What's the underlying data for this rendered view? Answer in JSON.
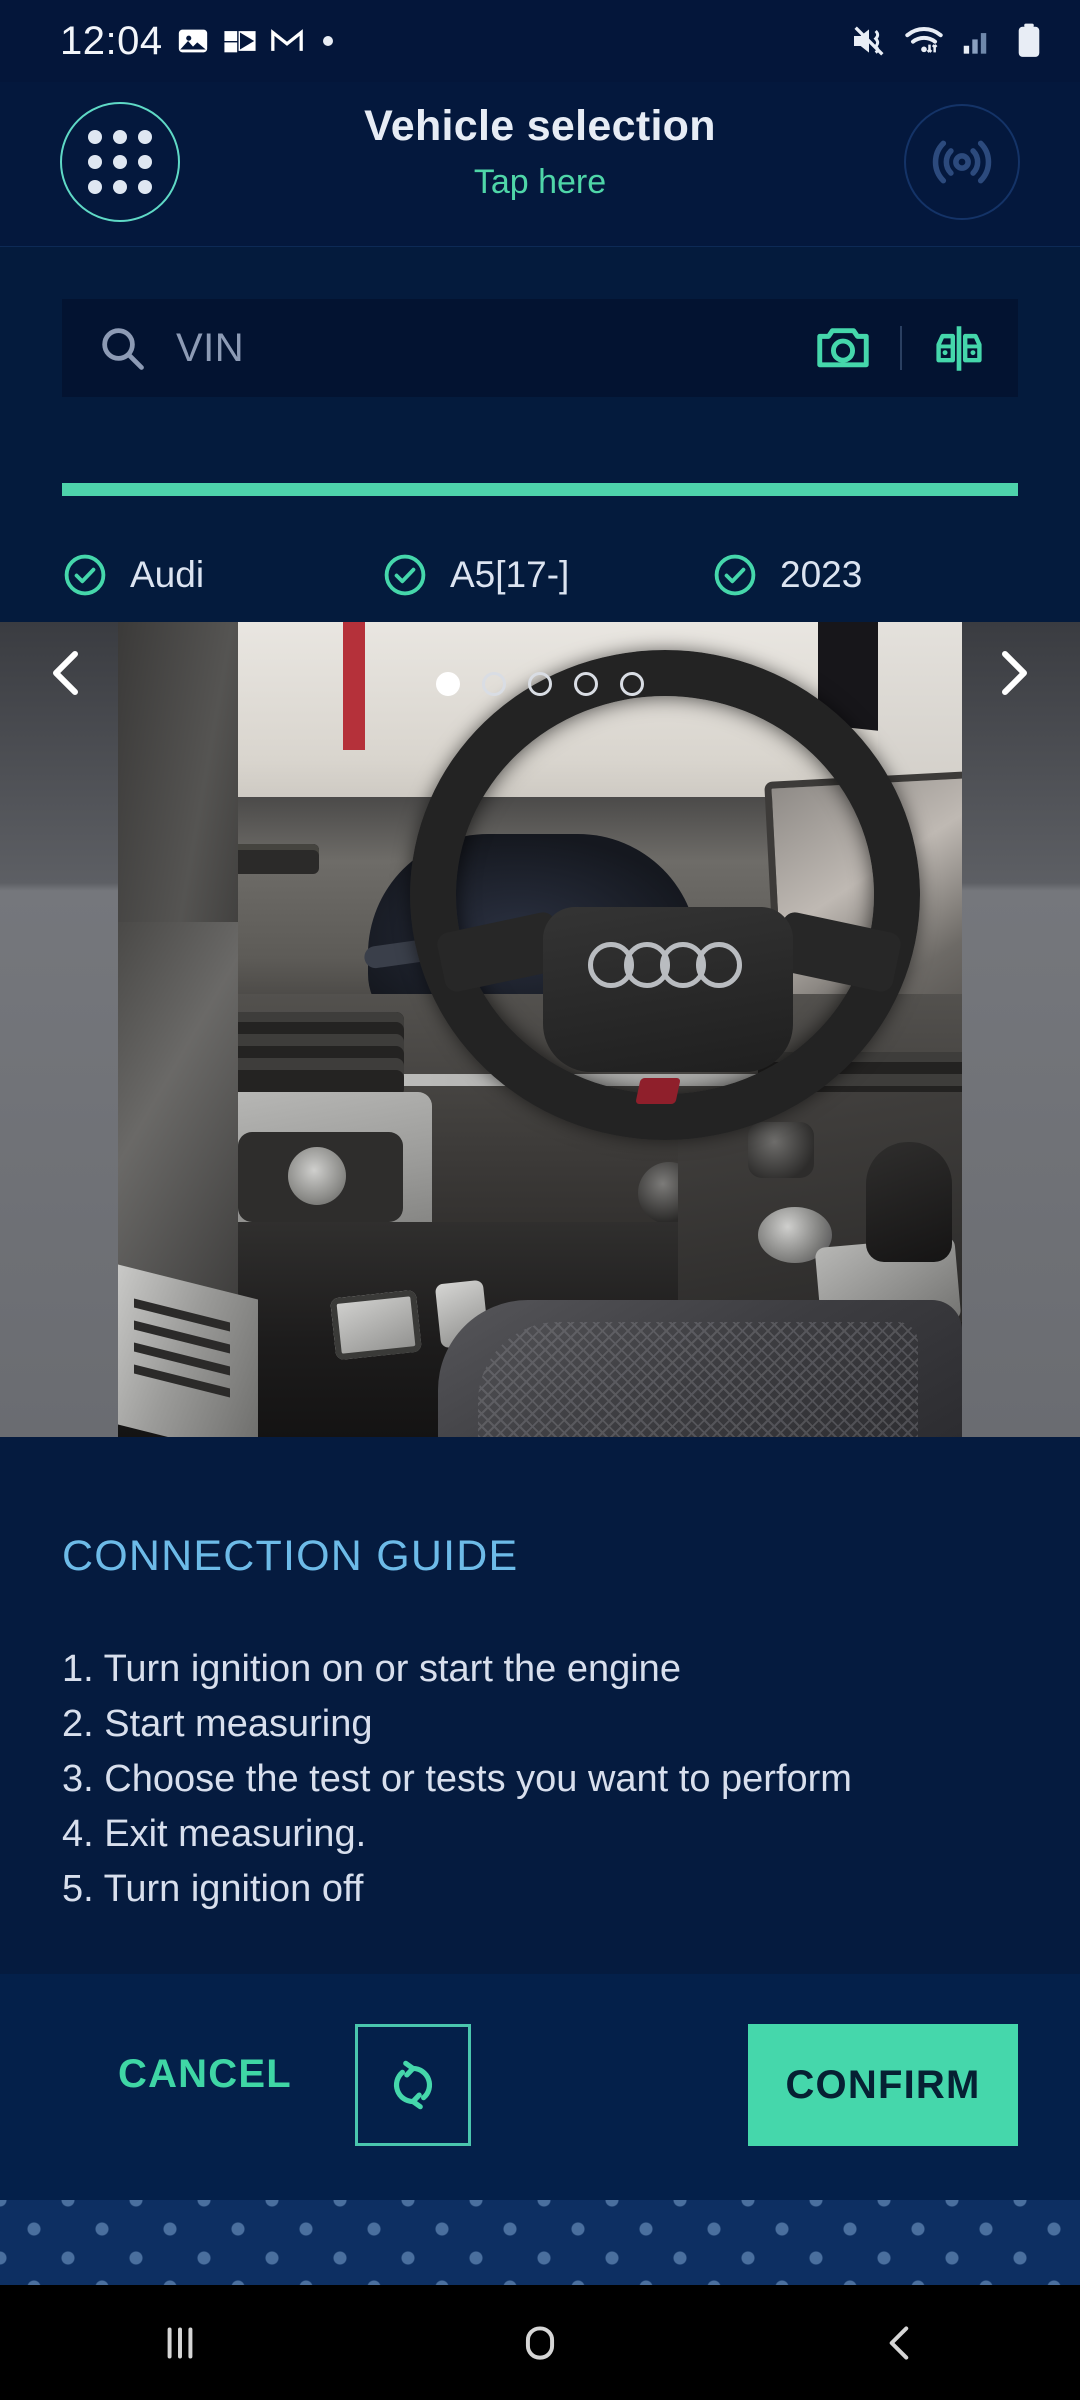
{
  "status_bar": {
    "time": "12:04",
    "left_icons": [
      "photos-icon",
      "outlook-icon",
      "gmail-icon",
      "notification-dot-icon"
    ],
    "right_icons": [
      "mute-vibrate-icon",
      "wifi-icon",
      "cellular-signal-icon",
      "battery-icon"
    ]
  },
  "header": {
    "menu_icon": "app-grid-icon",
    "title": "Vehicle selection",
    "subtitle": "Tap here",
    "connection_icon": "wireless-connection-icon"
  },
  "search": {
    "icon": "search-icon",
    "placeholder": "VIN",
    "value": "",
    "camera_icon": "camera-icon",
    "vin_scan_icon": "vehicle-compare-icon"
  },
  "progress": {
    "percent": 100,
    "fill_color": "#4ed3ab"
  },
  "vehicle_chips": [
    {
      "label": "Audi",
      "icon": "check-circle-icon",
      "selected": true
    },
    {
      "label": "A5[17-]",
      "icon": "check-circle-icon",
      "selected": true
    },
    {
      "label": "2023",
      "icon": "check-circle-icon",
      "selected": true
    }
  ],
  "carousel": {
    "prev_icon": "chevron-left-icon",
    "next_icon": "chevron-right-icon",
    "total_slides": 5,
    "active_slide": 1,
    "image_alt": "Audi A5 interior dashboard with steering wheel"
  },
  "guide": {
    "title": "CONNECTION GUIDE",
    "steps": [
      "1. Turn ignition on or start the engine",
      "2. Start measuring",
      "3. Choose the test or tests you want to perform",
      "4. Exit measuring.",
      "5. Turn ignition off"
    ]
  },
  "actions": {
    "cancel_label": "CANCEL",
    "refresh_icon": "refresh-icon",
    "confirm_label": "CONFIRM"
  },
  "nav_bar": {
    "recents_icon": "recents-icon",
    "home_icon": "home-icon",
    "back_icon": "back-icon"
  },
  "colors": {
    "background": "#041b3d",
    "header_bg": "#04183d",
    "accent_green": "#45d7ab",
    "accent_teal": "#5fd9c6",
    "guide_title_blue": "#6dbbe8",
    "text_primary": "#dce4f1",
    "search_bg": "#031331"
  }
}
